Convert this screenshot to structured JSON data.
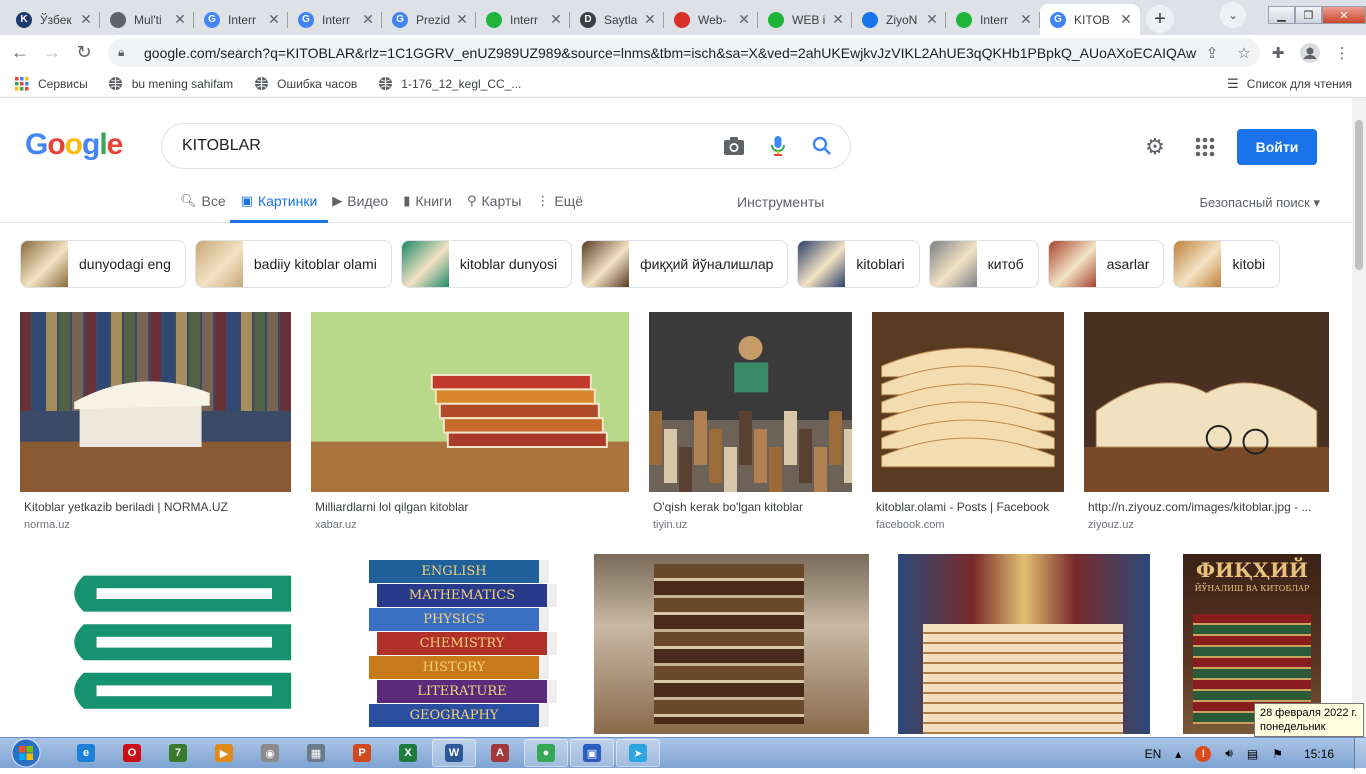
{
  "browser": {
    "tabs": [
      {
        "title": "Ўзбек",
        "favicon": "k-icon",
        "color": "#1f3b6e"
      },
      {
        "title": "Mul'ti",
        "favicon": "globe-icon",
        "color": "#5f6368"
      },
      {
        "title": "Interr",
        "favicon": "google-icon",
        "color": "#4285f4"
      },
      {
        "title": "Interr",
        "favicon": "google-icon",
        "color": "#4285f4"
      },
      {
        "title": "Prezid",
        "favicon": "google-icon",
        "color": "#4285f4"
      },
      {
        "title": "Interr",
        "favicon": "uz-flag-icon",
        "color": "#1eb53a"
      },
      {
        "title": "Saytla",
        "favicon": "d-icon",
        "color": "#3c4043"
      },
      {
        "title": "Web-",
        "favicon": "o-icon",
        "color": "#d93025"
      },
      {
        "title": "WEB i",
        "favicon": "uz-flag-icon",
        "color": "#1eb53a"
      },
      {
        "title": "ZiyoN",
        "favicon": "chart-icon",
        "color": "#1a73e8"
      },
      {
        "title": "Interr",
        "favicon": "uz-flag-icon",
        "color": "#1eb53a"
      },
      {
        "title": "KITOB",
        "favicon": "google-icon",
        "color": "#4285f4",
        "active": true
      }
    ],
    "new_tab": "+",
    "tab_dropdown": "⌄",
    "url": "google.com/search?q=KITOBLAR&rlz=1C1GGRV_enUZ989UZ989&source=lnms&tbm=isch&sa=X&ved=2ahUKEwjkvJzVIKL2AhUE3qQKHb1PBpkQ_AUoAXoECAIQAw&...",
    "bookmarks": [
      {
        "label": "Сервисы",
        "icon": "apps-grid-icon"
      },
      {
        "label": "bu mening sahifam",
        "icon": "globe-icon"
      },
      {
        "label": "Ошибка часов",
        "icon": "globe-icon"
      },
      {
        "label": "1-176_12_kegl_CC_...",
        "icon": "globe-icon"
      }
    ],
    "reading_list": "Список для чтения"
  },
  "google": {
    "logo": [
      "G",
      "o",
      "o",
      "g",
      "l",
      "e"
    ],
    "logo_colors": [
      "#4285f4",
      "#ea4335",
      "#fbbc05",
      "#4285f4",
      "#34a853",
      "#ea4335"
    ],
    "query": "KITOBLAR",
    "sign_in": "Войти",
    "tabs": [
      {
        "label": "Все",
        "icon": "search-icon"
      },
      {
        "label": "Картинки",
        "icon": "image-icon",
        "active": true
      },
      {
        "label": "Видео",
        "icon": "play-icon"
      },
      {
        "label": "Книги",
        "icon": "book-icon"
      },
      {
        "label": "Карты",
        "icon": "map-pin-icon"
      },
      {
        "label": "Ещё",
        "icon": "more-vert-icon"
      }
    ],
    "tools": "Инструменты",
    "safe_search": "Безопасный поиск ▾",
    "chips": [
      {
        "label": "dunyodagi eng",
        "thumb": "#8a6a3c"
      },
      {
        "label": "badiiy kitoblar olami",
        "thumb": "#c9a77a"
      },
      {
        "label": "kitoblar dunyosi",
        "thumb": "#1d8a6a"
      },
      {
        "label": "фиқҳий йўналишлар",
        "thumb": "#5a3b24"
      },
      {
        "label": "kitoblari",
        "thumb": "#2d3e6b"
      },
      {
        "label": "китоб",
        "thumb": "#7b7f86"
      },
      {
        "label": "asarlar",
        "thumb": "#a6442e"
      },
      {
        "label": "kitobi",
        "thumb": "#c0803a"
      }
    ],
    "results": [
      {
        "caption": "Kitoblar yetkazib beriladi | NORMA.UZ",
        "source": "norma.uz",
        "tone": "library"
      },
      {
        "caption": "Milliardlarni lol qilgan kitoblar",
        "source": "xabar.uz",
        "tone": "green-stack"
      },
      {
        "caption": "O'qish kerak bo'lgan kitoblar",
        "source": "tiyin.uz",
        "tone": "reader"
      },
      {
        "caption": "kitoblar.olami - Posts | Facebook",
        "source": "facebook.com",
        "tone": "open-books"
      },
      {
        "caption": "http://n.ziyouz.com/images/kitoblar.jpg - ...",
        "source": "ziyouz.uz",
        "tone": "glasses"
      },
      {
        "caption": "",
        "source": "",
        "tone": "green-icon"
      },
      {
        "caption": "",
        "source": "",
        "tone": "subjects",
        "spines": [
          "ENGLISH",
          "MATHEMATICS",
          "PHYSICS",
          "CHEMISTRY",
          "HISTORY",
          "LITERATURE",
          "GEOGRAPHY"
        ]
      },
      {
        "caption": "",
        "source": "",
        "tone": "old-books"
      },
      {
        "caption": "",
        "source": "",
        "tone": "fan-book"
      },
      {
        "caption": "",
        "source": "",
        "tone": "fiqh",
        "cover_title": "ФИҚҲИЙ",
        "cover_sub": "ЙЎНАЛИШ ВА КИТОБЛАР"
      }
    ]
  },
  "tooltip": {
    "line1": "28 февраля 2022 г.",
    "line2": "понедельник"
  },
  "taskbar": {
    "apps": [
      {
        "name": "ie",
        "glyph": "e",
        "color": "#1e7fd6"
      },
      {
        "name": "opera",
        "glyph": "O",
        "color": "#cc0f16"
      },
      {
        "name": "7zip",
        "glyph": "7",
        "color": "#3a7a2a"
      },
      {
        "name": "media",
        "glyph": "▶",
        "color": "#e08a1a"
      },
      {
        "name": "utility",
        "glyph": "◉",
        "color": "#8a8a8a"
      },
      {
        "name": "calculator",
        "glyph": "▦",
        "color": "#6b7b8c"
      },
      {
        "name": "powerpoint",
        "glyph": "P",
        "color": "#d04a1f"
      },
      {
        "name": "excel",
        "glyph": "X",
        "color": "#1f7a3e"
      },
      {
        "name": "word",
        "glyph": "W",
        "color": "#2b5797",
        "running": true
      },
      {
        "name": "access",
        "glyph": "A",
        "color": "#a4373a"
      },
      {
        "name": "chrome",
        "glyph": "●",
        "color": "#34a853",
        "running": true
      },
      {
        "name": "save-app",
        "glyph": "▣",
        "color": "#2a5bbf",
        "running": true
      },
      {
        "name": "telegram",
        "glyph": "➤",
        "color": "#2ca5e0",
        "running": true
      }
    ],
    "lang": "EN",
    "time": "15:16"
  }
}
